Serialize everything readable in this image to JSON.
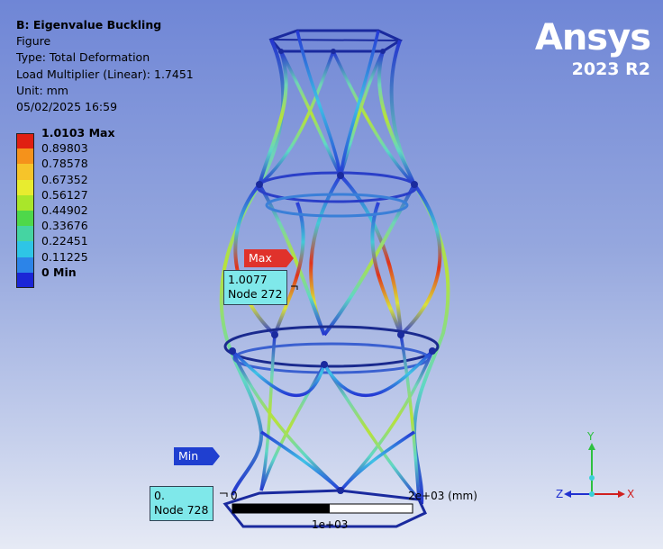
{
  "info": {
    "title": "B: Eigenvalue Buckling",
    "lines": [
      "Figure",
      "Type: Total Deformation",
      "Load Multiplier (Linear): 1.7451",
      "Unit: mm",
      "05/02/2025 16:59"
    ]
  },
  "logo": {
    "brand": "Ansys",
    "version": "2023 R2"
  },
  "legend": {
    "rows": [
      {
        "label": "1.0103 Max",
        "color": "#e01f12"
      },
      {
        "label": "0.89803",
        "color": "#f5921b"
      },
      {
        "label": "0.78578",
        "color": "#f6c42a"
      },
      {
        "label": "0.67352",
        "color": "#e8ec2f"
      },
      {
        "label": "0.56127",
        "color": "#a9e62a"
      },
      {
        "label": "0.44902",
        "color": "#4ed84a"
      },
      {
        "label": "0.33676",
        "color": "#45d4a2"
      },
      {
        "label": "0.22451",
        "color": "#2ec5e6"
      },
      {
        "label": "0.11225",
        "color": "#2c84e8"
      },
      {
        "label": "0 Min",
        "color": "#1b26d6"
      }
    ]
  },
  "probes": {
    "max": {
      "flag": "Max",
      "value": "1.0077",
      "node": "Node 272"
    },
    "min": {
      "flag": "Min",
      "value": "0.",
      "node": "Node 728"
    }
  },
  "scale": {
    "zero": "0",
    "end": "2e+03 (mm)",
    "mid": "1e+03"
  },
  "triad": {
    "x": "X",
    "y": "Y",
    "z": "Z"
  }
}
